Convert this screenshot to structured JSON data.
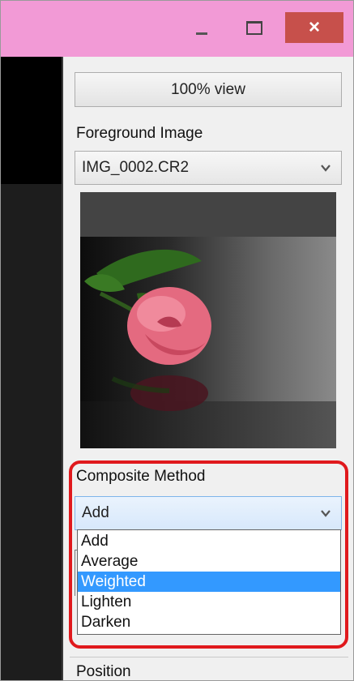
{
  "window": {
    "buttons": {
      "minimize": "minimize",
      "maximize": "maximize",
      "close": "×"
    }
  },
  "toolbar": {
    "view_100_label": "100% view"
  },
  "foreground": {
    "label": "Foreground Image",
    "selected": "IMG_0002.CR2",
    "preview_icon": "rose-photo-thumbnail"
  },
  "composite": {
    "label": "Composite Method",
    "selected": "Add",
    "options": [
      "Add",
      "Average",
      "Weighted",
      "Lighten",
      "Darken"
    ],
    "highlighted_index": 2,
    "highlight_color": "#e0191d"
  },
  "position": {
    "label": "Position"
  },
  "colors": {
    "titlebar": "#f29ad6",
    "close_button": "#c7504b",
    "selection": "#3399ff"
  }
}
